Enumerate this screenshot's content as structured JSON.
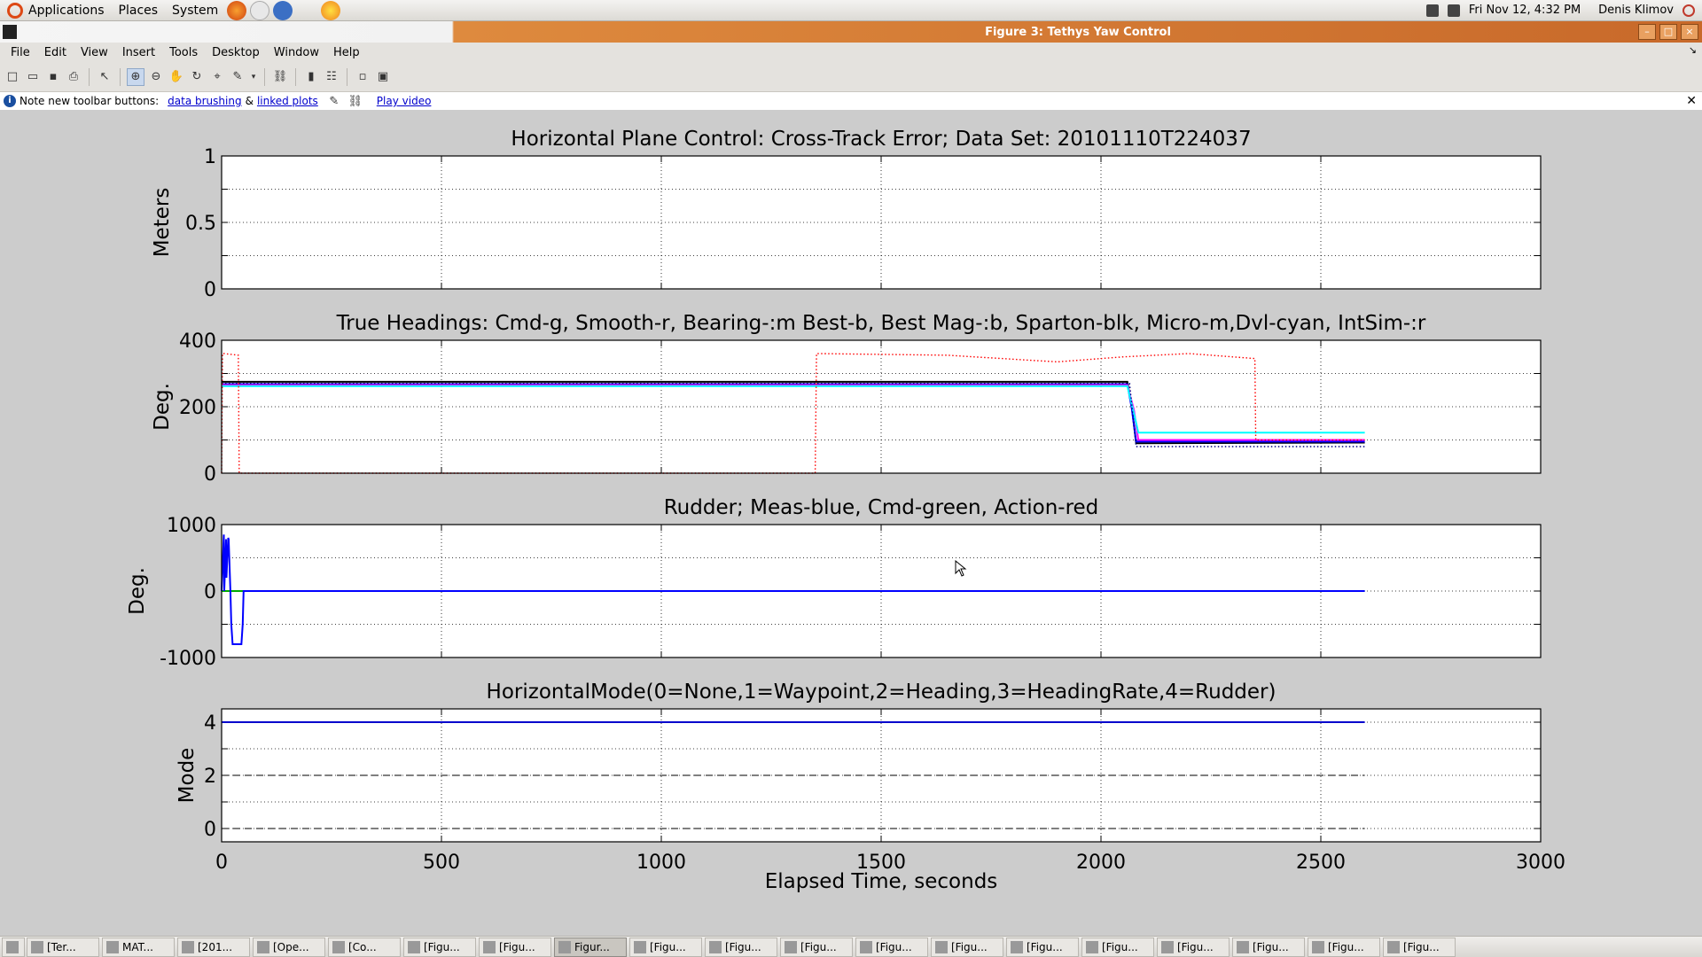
{
  "top_panel": {
    "menus": [
      "Applications",
      "Places",
      "System"
    ],
    "datetime": "Fri Nov 12,  4:32 PM",
    "user": "Denis Klimov"
  },
  "window": {
    "title": "Figure 3: Tethys Yaw Control"
  },
  "menubar": [
    "File",
    "Edit",
    "View",
    "Insert",
    "Tools",
    "Desktop",
    "Window",
    "Help"
  ],
  "toolbar": {
    "icons": [
      "new-figure-icon",
      "open-file-icon",
      "save-icon",
      "print-icon",
      "edit-plot-icon",
      "zoom-in-icon",
      "zoom-out-icon",
      "pan-icon",
      "rotate-icon",
      "data-cursor-icon",
      "brush-icon",
      "link-plot-icon",
      "colorbar-icon",
      "legend-icon",
      "hide-tools-icon",
      "show-tools-icon"
    ]
  },
  "infobar": {
    "note": "Note new toolbar buttons:",
    "link1": "data brushing",
    "amp": "&",
    "link2": "linked plots",
    "link3": "Play video"
  },
  "chart_data": [
    {
      "type": "line",
      "title": "Horizontal Plane Control: Cross-Track Error; Data Set: 20101110T224037",
      "ylabel": "Meters",
      "xlim": [
        0,
        3000
      ],
      "ylim": [
        0,
        1
      ],
      "yticks": [
        "0",
        "0.5",
        "1"
      ],
      "grid": true,
      "series": []
    },
    {
      "type": "line",
      "title": "True Headings: Cmd-g, Smooth-r, Bearing-:m Best-b, Best Mag-:b, Sparton-blk, Micro-m,Dvl-cyan, IntSim-:r",
      "ylabel": "Deg.",
      "xlim": [
        0,
        3000
      ],
      "ylim": [
        0,
        400
      ],
      "yticks": [
        "0",
        "200",
        "400"
      ],
      "grid": true,
      "series": [
        {
          "color": "#000000",
          "style": "solid",
          "x": [
            0,
            2060,
            2070,
            2080,
            2600
          ],
          "y": [
            275,
            275,
            200,
            90,
            92
          ]
        },
        {
          "color": "#0000ff",
          "style": "solid",
          "x": [
            0,
            2060,
            2070,
            2080,
            2600
          ],
          "y": [
            268,
            268,
            195,
            95,
            95
          ]
        },
        {
          "color": "#ff00ff",
          "style": "solid",
          "x": [
            0,
            2060,
            2075,
            2085,
            2600
          ],
          "y": [
            265,
            265,
            190,
            100,
            100
          ]
        },
        {
          "color": "#00ffff",
          "style": "solid",
          "x": [
            0,
            2060,
            2075,
            2085,
            2600
          ],
          "y": [
            262,
            262,
            180,
            122,
            122
          ]
        },
        {
          "color": "#000080",
          "style": "dotted",
          "x": [
            0,
            2065,
            2080,
            2600
          ],
          "y": [
            270,
            270,
            80,
            80
          ]
        },
        {
          "color": "#ff0000",
          "style": "dotted",
          "x": [
            0,
            2,
            5,
            38,
            40,
            1350,
            1353,
            1650,
            1900,
            2050,
            2200,
            2350,
            2352,
            2600
          ],
          "y": [
            0,
            360,
            360,
            355,
            0,
            0,
            360,
            355,
            335,
            350,
            360,
            345,
            100,
            100
          ]
        }
      ]
    },
    {
      "type": "line",
      "title": "Rudder; Meas-blue, Cmd-green, Action-red",
      "ylabel": "Deg.",
      "xlim": [
        0,
        3000
      ],
      "ylim": [
        -1000,
        1000
      ],
      "yticks": [
        "-1000",
        "0",
        "1000"
      ],
      "grid": true,
      "series": [
        {
          "color": "#00aa00",
          "style": "solid",
          "x": [
            0,
            2600
          ],
          "y": [
            0,
            0
          ]
        },
        {
          "color": "#0000ff",
          "style": "solid",
          "x": [
            0,
            5,
            6,
            10,
            11,
            15,
            16,
            20,
            22,
            25,
            30,
            35,
            40,
            45,
            48,
            50,
            2600
          ],
          "y": [
            0,
            850,
            0,
            780,
            200,
            800,
            780,
            0,
            -500,
            -800,
            -800,
            -800,
            -800,
            -800,
            -500,
            0,
            0
          ]
        }
      ]
    },
    {
      "type": "line",
      "title": "HorizontalMode(0=None,1=Waypoint,2=Heading,3=HeadingRate,4=Rudder)",
      "ylabel": "Mode",
      "xlabel": "Elapsed Time,  seconds",
      "xlim": [
        0,
        3000
      ],
      "ylim": [
        -0.5,
        4.5
      ],
      "yticks": [
        "0",
        "2",
        "4"
      ],
      "xticks": [
        "0",
        "500",
        "1000",
        "1500",
        "2000",
        "2500",
        "3000"
      ],
      "grid": true,
      "series": [
        {
          "color": "#0000cc",
          "style": "solid",
          "x": [
            0,
            2600
          ],
          "y": [
            4,
            4
          ]
        },
        {
          "color": "#555555",
          "style": "dashed",
          "x": [
            0,
            2600
          ],
          "y": [
            2,
            2
          ]
        },
        {
          "color": "#555555",
          "style": "dashed",
          "x": [
            0,
            2600
          ],
          "y": [
            0,
            0
          ]
        }
      ]
    }
  ],
  "taskbar": {
    "items": [
      "[Ter...",
      "MAT...",
      "[201...",
      "[Ope...",
      "[Co...",
      "[Figu...",
      "[Figu...",
      "Figur...",
      "[Figu...",
      "[Figu...",
      "[Figu...",
      "[Figu...",
      "[Figu...",
      "[Figu...",
      "[Figu...",
      "[Figu...",
      "[Figu...",
      "[Figu...",
      "[Figu..."
    ],
    "active_index": 7
  }
}
